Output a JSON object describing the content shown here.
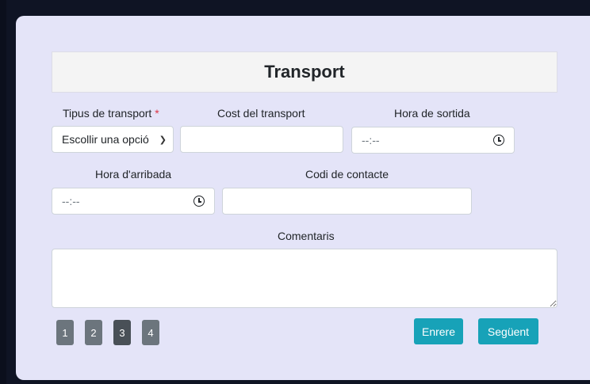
{
  "form": {
    "title": "Transport",
    "transport_type": {
      "label": "Tipus de transport",
      "required_mark": "*",
      "selected": "Escollir una opció"
    },
    "cost": {
      "label": "Cost del transport",
      "value": ""
    },
    "departure_time": {
      "label": "Hora de sortida",
      "value": "--:--"
    },
    "arrival_time": {
      "label": "Hora d'arribada",
      "value": "--:--"
    },
    "contact_code": {
      "label": "Codi de contacte",
      "value": ""
    },
    "comments": {
      "label": "Comentaris",
      "value": ""
    }
  },
  "pagination": {
    "pages": [
      "1",
      "2",
      "3",
      "4"
    ],
    "active_page": "3"
  },
  "nav": {
    "back_label": "Enrere",
    "next_label": "Següent"
  },
  "colors": {
    "card_background": "#e4e4f8",
    "page_button": "#6c757d",
    "page_button_active": "#495057",
    "nav_button": "#17a2b8",
    "required": "#dc3545"
  }
}
